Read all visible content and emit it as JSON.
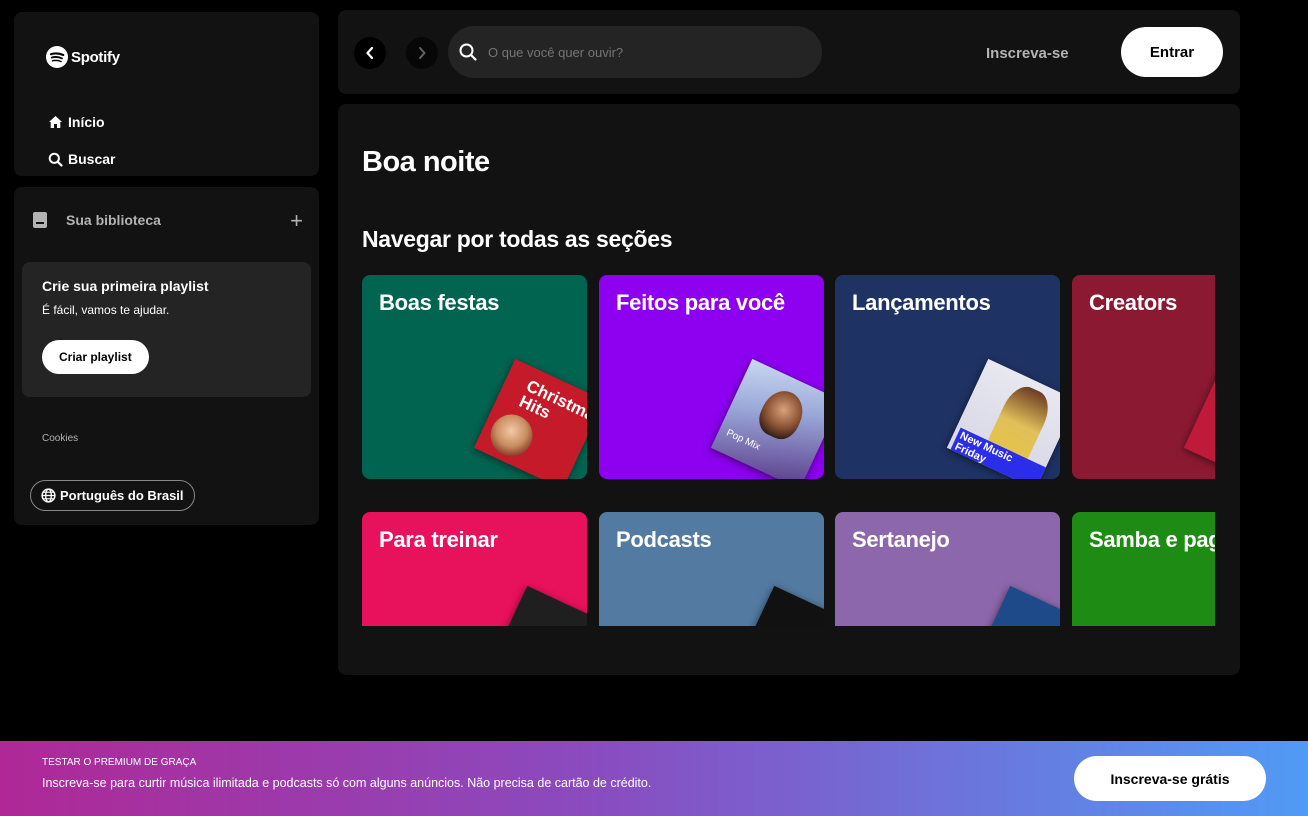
{
  "brand": {
    "name": "Spotify"
  },
  "nav": {
    "home": "Início",
    "search": "Buscar"
  },
  "library": {
    "title": "Sua biblioteca",
    "add": "+",
    "promo_title": "Crie sua primeira playlist",
    "promo_sub": "É fácil, vamos te ajudar.",
    "promo_button": "Criar playlist",
    "cookies": "Cookies",
    "language": "Português do Brasil"
  },
  "topbar": {
    "search_placeholder": "O que você quer ouvir?",
    "signup": "Inscreva-se",
    "login": "Entrar"
  },
  "main": {
    "greeting": "Boa noite",
    "section_title": "Navegar por todas as seções",
    "cards": [
      {
        "label": "Boas festas",
        "color": "#006450",
        "art_text": "Christmas Hits"
      },
      {
        "label": "Feitos para você",
        "color": "#8d00f0",
        "art_text": "Pop Mix"
      },
      {
        "label": "Lançamentos",
        "color": "#1e3264",
        "art_text": "New Music Friday"
      },
      {
        "label": "Creators",
        "color": "#8c1932"
      },
      {
        "label": "Para treinar",
        "color": "#e8115b"
      },
      {
        "label": "Podcasts",
        "color": "#537aa1"
      },
      {
        "label": "Sertanejo",
        "color": "#8d67ab"
      },
      {
        "label": "Samba e pagode",
        "color": "#1e8c14"
      }
    ]
  },
  "banner": {
    "kicker": "TESTAR O PREMIUM DE GRAÇA",
    "message": "Inscreva-se para curtir música ilimitada e podcasts só com alguns anúncios. Não precisa de cartão de crédito.",
    "cta": "Inscreva-se grátis"
  }
}
